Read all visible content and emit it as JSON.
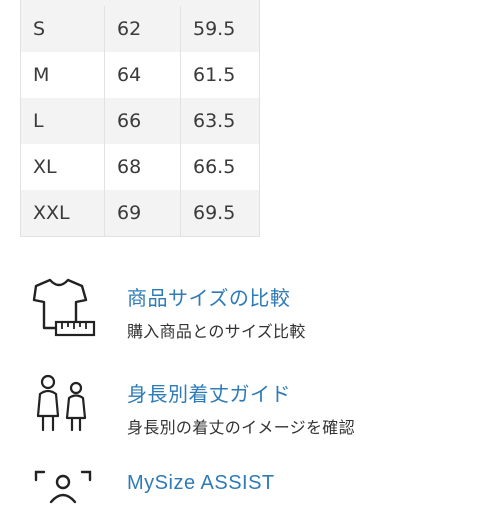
{
  "size_table": {
    "rows": [
      {
        "size": "S",
        "a": "62",
        "b": "59.5"
      },
      {
        "size": "M",
        "a": "64",
        "b": "61.5"
      },
      {
        "size": "L",
        "a": "66",
        "b": "63.5"
      },
      {
        "size": "XL",
        "a": "68",
        "b": "66.5"
      },
      {
        "size": "XXL",
        "a": "69",
        "b": "69.5"
      }
    ]
  },
  "links": {
    "compare": {
      "title": "商品サイズの比較",
      "description": "購入商品とのサイズ比較",
      "icon": "tshirt-measure-icon"
    },
    "length_guide": {
      "title": "身長別着丈ガイド",
      "description": "身長別の着丈のイメージを確認",
      "icon": "people-height-icon"
    },
    "mysize": {
      "title": "MySize ASSIST",
      "icon": "body-scan-icon"
    }
  },
  "colors": {
    "link": "#2e7bb8",
    "text": "#333333",
    "row_alt": "#f3f3f3",
    "border": "#e2e2e2"
  }
}
